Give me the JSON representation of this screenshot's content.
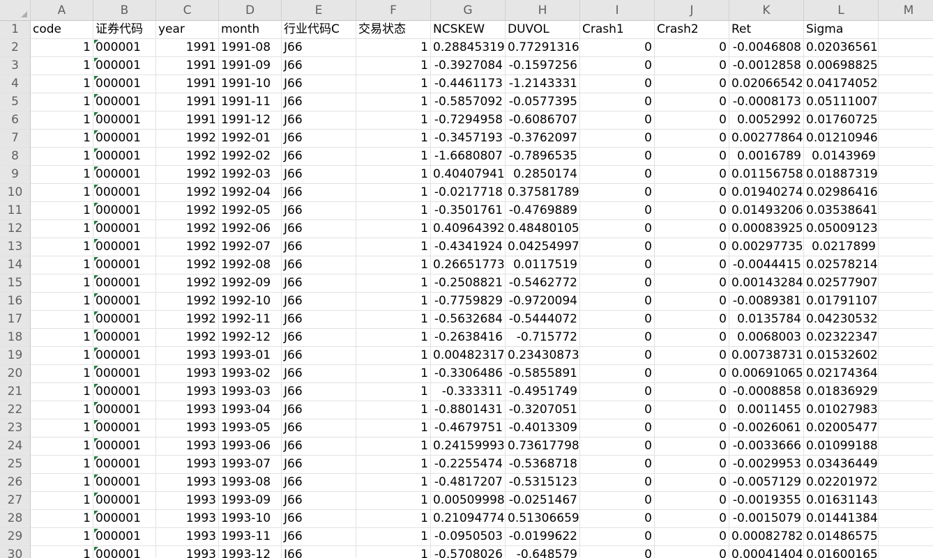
{
  "column_letters": [
    "A",
    "B",
    "C",
    "D",
    "E",
    "F",
    "G",
    "H",
    "I",
    "J",
    "K",
    "L",
    "M"
  ],
  "headers": [
    "code",
    "证券代码",
    "year",
    "month",
    "行业代码C",
    "交易状态",
    "NCSKEW",
    "DUVOL",
    "Crash1",
    "Crash2",
    "Ret",
    "Sigma",
    ""
  ],
  "rows": [
    [
      "1",
      "000001",
      "1991",
      "1991-08",
      "J66",
      "1",
      "0.28845319",
      "0.77291316",
      "0",
      "0",
      "-0.0046808",
      "0.02036561"
    ],
    [
      "1",
      "000001",
      "1991",
      "1991-09",
      "J66",
      "1",
      "-0.3927084",
      "-0.1597256",
      "0",
      "0",
      "-0.0012858",
      "0.00698825"
    ],
    [
      "1",
      "000001",
      "1991",
      "1991-10",
      "J66",
      "1",
      "-0.4461173",
      "-1.2143331",
      "0",
      "0",
      "0.02066542",
      "0.04174052"
    ],
    [
      "1",
      "000001",
      "1991",
      "1991-11",
      "J66",
      "1",
      "-0.5857092",
      "-0.0577395",
      "0",
      "0",
      "-0.0008173",
      "0.05111007"
    ],
    [
      "1",
      "000001",
      "1991",
      "1991-12",
      "J66",
      "1",
      "-0.7294958",
      "-0.6086707",
      "0",
      "0",
      "0.0052992",
      "0.01760725"
    ],
    [
      "1",
      "000001",
      "1992",
      "1992-01",
      "J66",
      "1",
      "-0.3457193",
      "-0.3762097",
      "0",
      "0",
      "0.00277864",
      "0.01210946"
    ],
    [
      "1",
      "000001",
      "1992",
      "1992-02",
      "J66",
      "1",
      "-1.6680807",
      "-0.7896535",
      "0",
      "0",
      "0.0016789",
      "0.0143969"
    ],
    [
      "1",
      "000001",
      "1992",
      "1992-03",
      "J66",
      "1",
      "0.40407941",
      "0.2850174",
      "0",
      "0",
      "0.01156758",
      "0.01887319"
    ],
    [
      "1",
      "000001",
      "1992",
      "1992-04",
      "J66",
      "1",
      "-0.0217718",
      "0.37581789",
      "0",
      "0",
      "0.01940274",
      "0.02986416"
    ],
    [
      "1",
      "000001",
      "1992",
      "1992-05",
      "J66",
      "1",
      "-0.3501761",
      "-0.4769889",
      "0",
      "0",
      "0.01493206",
      "0.03538641"
    ],
    [
      "1",
      "000001",
      "1992",
      "1992-06",
      "J66",
      "1",
      "0.40964392",
      "0.48480105",
      "0",
      "0",
      "0.00083925",
      "0.05009123"
    ],
    [
      "1",
      "000001",
      "1992",
      "1992-07",
      "J66",
      "1",
      "-0.4341924",
      "0.04254997",
      "0",
      "0",
      "0.00297735",
      "0.0217899"
    ],
    [
      "1",
      "000001",
      "1992",
      "1992-08",
      "J66",
      "1",
      "0.26651773",
      "0.0117519",
      "0",
      "0",
      "-0.0044415",
      "0.02578214"
    ],
    [
      "1",
      "000001",
      "1992",
      "1992-09",
      "J66",
      "1",
      "-0.2508821",
      "-0.5462772",
      "0",
      "0",
      "0.00143284",
      "0.02577907"
    ],
    [
      "1",
      "000001",
      "1992",
      "1992-10",
      "J66",
      "1",
      "-0.7759829",
      "-0.9720094",
      "0",
      "0",
      "-0.0089381",
      "0.01791107"
    ],
    [
      "1",
      "000001",
      "1992",
      "1992-11",
      "J66",
      "1",
      "-0.5632684",
      "-0.5444072",
      "0",
      "0",
      "0.0135784",
      "0.04230532"
    ],
    [
      "1",
      "000001",
      "1992",
      "1992-12",
      "J66",
      "1",
      "-0.2638416",
      "-0.715772",
      "0",
      "0",
      "0.0068003",
      "0.02322347"
    ],
    [
      "1",
      "000001",
      "1993",
      "1993-01",
      "J66",
      "1",
      "0.00482317",
      "0.23430873",
      "0",
      "0",
      "0.00738731",
      "0.01532602"
    ],
    [
      "1",
      "000001",
      "1993",
      "1993-02",
      "J66",
      "1",
      "-0.3306486",
      "-0.5855891",
      "0",
      "0",
      "0.00691065",
      "0.02174364"
    ],
    [
      "1",
      "000001",
      "1993",
      "1993-03",
      "J66",
      "1",
      "-0.333311",
      "-0.4951749",
      "0",
      "0",
      "-0.0008858",
      "0.01836929"
    ],
    [
      "1",
      "000001",
      "1993",
      "1993-04",
      "J66",
      "1",
      "-0.8801431",
      "-0.3207051",
      "0",
      "0",
      "0.0011455",
      "0.01027983"
    ],
    [
      "1",
      "000001",
      "1993",
      "1993-05",
      "J66",
      "1",
      "-0.4679751",
      "-0.4013309",
      "0",
      "0",
      "-0.0026061",
      "0.02005477"
    ],
    [
      "1",
      "000001",
      "1993",
      "1993-06",
      "J66",
      "1",
      "0.24159993",
      "0.73617798",
      "0",
      "0",
      "-0.0033666",
      "0.01099188"
    ],
    [
      "1",
      "000001",
      "1993",
      "1993-07",
      "J66",
      "1",
      "-0.2255474",
      "-0.5368718",
      "0",
      "0",
      "-0.0029953",
      "0.03436449"
    ],
    [
      "1",
      "000001",
      "1993",
      "1993-08",
      "J66",
      "1",
      "-0.4817207",
      "-0.5315123",
      "0",
      "0",
      "-0.0057129",
      "0.02201972"
    ],
    [
      "1",
      "000001",
      "1993",
      "1993-09",
      "J66",
      "1",
      "0.00509998",
      "-0.0251467",
      "0",
      "0",
      "-0.0019355",
      "0.01631143"
    ],
    [
      "1",
      "000001",
      "1993",
      "1993-10",
      "J66",
      "1",
      "0.21094774",
      "0.51306659",
      "0",
      "0",
      "-0.0015079",
      "0.01441384"
    ],
    [
      "1",
      "000001",
      "1993",
      "1993-11",
      "J66",
      "1",
      "-0.0950503",
      "-0.0199622",
      "0",
      "0",
      "0.00082782",
      "0.01486575"
    ],
    [
      "1",
      "000001",
      "1993",
      "1993-12",
      "J66",
      "1",
      "-0.5708026",
      "-0.648579",
      "0",
      "0",
      "0.00041404",
      "0.01600165"
    ]
  ]
}
